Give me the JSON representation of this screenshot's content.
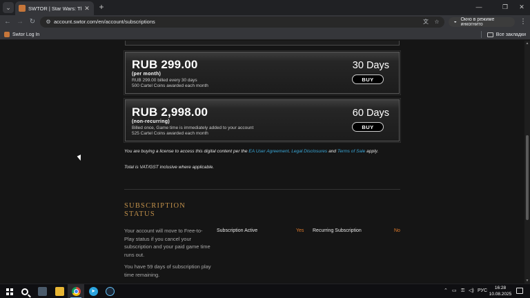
{
  "browser": {
    "tab_title": "SWTOR | Star Wars: The Old Re",
    "url": "account.swtor.com/en/account/subscriptions",
    "incognito_label": "Окно в режиме инкогнито",
    "bookmark": "Swtor Log In",
    "all_bookmarks": "Все закладки",
    "glyphs": {
      "tab_menu": "⌄",
      "close": "✕",
      "new_tab": "+",
      "minimize": "—",
      "maximize": "❐",
      "back": "←",
      "forward": "→",
      "reload": "↻",
      "site_info": "⚙",
      "translate": "文",
      "star": "☆",
      "incognito": "◒",
      "menu": "⋮"
    }
  },
  "plans": [
    {
      "price": "RUB 299.00",
      "term": "(per month)",
      "details": [
        "RUB 299.00 billed every 30 days",
        "500 Cartel Coins awarded each month"
      ],
      "duration": "30 Days",
      "buy_label": "BUY"
    },
    {
      "price": "RUB 2,998.00",
      "term": "(non-recurring)",
      "details": [
        "Billed once, Game time is immediately added to your account",
        "525 Cartel Coins awarded each month"
      ],
      "duration": "60 Days",
      "buy_label": "BUY"
    }
  ],
  "legal": {
    "intro": "You are buying a license to access this digital content per the",
    "ea_link": "EA User Agreement",
    "sep1": ". ",
    "disclosures_link": "Legal Disclosures",
    "and": " and ",
    "terms_link": "Terms of Sale",
    "apply": " apply.",
    "vat": "Total is VAT/GST inclusive where applicable."
  },
  "subscription_status": {
    "heading": "SUBSCRIPTION STATUS",
    "paragraph1": "Your account will move to Free-to-Play status if you cancel your subscription and your paid game time runs out.",
    "paragraph2": "You have 59 days of subscription play time remaining.",
    "active_label": "Subscription Active",
    "active_value": "Yes",
    "recurring_label": "Recurring Subscription",
    "recurring_value": "No"
  },
  "taskbar": {
    "clock_time": "16:28",
    "clock_date": "10.08.2025",
    "language": "РУС",
    "tray_glyphs": {
      "chevron": "⌃",
      "network": "▭",
      "volume": "◁)"
    }
  },
  "scrollbar": {
    "up": "▲",
    "down": "▼"
  },
  "colors": {
    "accent_gold": "#c1904a",
    "link_blue": "#3aa8d8",
    "status_orange": "#e07a2a",
    "page_bg": "#151515"
  }
}
